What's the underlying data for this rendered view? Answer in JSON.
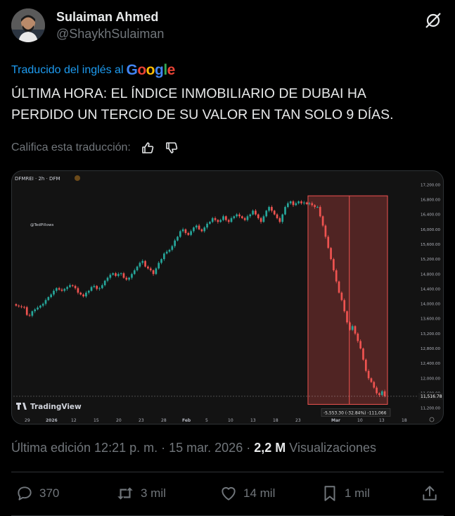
{
  "author": {
    "name": "Sulaiman Ahmed",
    "handle": "@ShaykhSulaiman"
  },
  "translation": {
    "label": "Traducido del inglés al",
    "provider": "Google",
    "rate_label": "Califica esta traducción:"
  },
  "tweet": {
    "text_line1": "ÚLTIMA HORA: EL ÍNDICE INMOBILIARIO DE DUBAI HA",
    "text_line2": "PERDIDO UN TERCIO DE SU VALOR EN TAN SOLO 9 DÍAS."
  },
  "chart_image": {
    "symbol_label": "DFMREI · 2h · DFM",
    "watermark": "@TedPillows",
    "brand": "TradingView",
    "price_tag": "11,516.78",
    "measure_label": "-5,553.30 (-32.84%) -111,066",
    "y_ticks": [
      "17,200.00",
      "16,800.00",
      "16,400.00",
      "16,000.00",
      "15,600.00",
      "15,200.00",
      "14,800.00",
      "14,400.00",
      "14,000.00",
      "13,600.00",
      "13,200.00",
      "12,800.00",
      "12,400.00",
      "12,000.00",
      "11,600.00",
      "11,200.00"
    ],
    "x_ticks": [
      "29",
      "2026",
      "12",
      "15",
      "20",
      "23",
      "28",
      "Feb",
      "5",
      "10",
      "13",
      "18",
      "23",
      "Mar",
      "10",
      "13",
      "18"
    ],
    "colors": {
      "up": "#26a69a",
      "down": "#ef5350",
      "background": "#131313"
    }
  },
  "chart_data": {
    "type": "candlestick",
    "title": "DFMREI · 2h · DFM",
    "ylim": [
      11100,
      17300
    ],
    "y_ticks": [
      17200,
      16800,
      16400,
      16000,
      15600,
      15200,
      14800,
      14400,
      14000,
      13600,
      13200,
      12800,
      12400,
      12000,
      11600,
      11200
    ],
    "x_ticks": [
      "29",
      "2026",
      "12",
      "15",
      "20",
      "23",
      "28",
      "Feb",
      "5",
      "10",
      "13",
      "18",
      "23",
      "Mar",
      "10",
      "13",
      "18"
    ],
    "close_series": [
      13950,
      13930,
      13920,
      13910,
      13700,
      13680,
      13800,
      13850,
      13900,
      13950,
      14000,
      14100,
      14180,
      14250,
      14350,
      14420,
      14380,
      14350,
      14400,
      14450,
      14500,
      14480,
      14420,
      14300,
      14250,
      14200,
      14300,
      14350,
      14450,
      14480,
      14400,
      14420,
      14500,
      14620,
      14700,
      14780,
      14820,
      14750,
      14800,
      14820,
      14700,
      14650,
      14700,
      14800,
      14900,
      15000,
      15100,
      15150,
      15000,
      14950,
      14900,
      14800,
      14950,
      15100,
      15200,
      15350,
      15400,
      15450,
      15550,
      15700,
      15800,
      15950,
      16000,
      15900,
      15850,
      15950,
      16050,
      16100,
      16000,
      15950,
      16050,
      16150,
      16200,
      16300,
      16250,
      16200,
      16250,
      16350,
      16250,
      16200,
      16300,
      16350,
      16400,
      16350,
      16300,
      16250,
      16350,
      16400,
      16500,
      16400,
      16300,
      16200,
      16350,
      16500,
      16600,
      16500,
      16400,
      16300,
      16200,
      16400,
      16600,
      16700,
      16750,
      16650,
      16700,
      16750,
      16700,
      16720,
      16680,
      16700,
      16650,
      16600,
      16600,
      16350,
      16100,
      15800,
      15500,
      15200,
      14900,
      14600,
      14300,
      14100,
      13800,
      13500,
      13300,
      13400,
      13200,
      13000,
      12800,
      12500,
      12200,
      12000,
      11900,
      11750,
      11600,
      11550,
      11650,
      11520
    ],
    "annotations": {
      "last_price": 11516.78,
      "measured_move": "-5,553.30 (-32.84%) -111,066"
    }
  },
  "post_meta": {
    "edited": "Última edición 12:21 p. m.",
    "date": "15 mar. 2026",
    "views_count": "2,2 M",
    "views_label": "Visualizaciones"
  },
  "actions": {
    "replies": "370",
    "reposts": "3 mil",
    "likes": "14 mil",
    "bookmarks": "1 mil"
  }
}
